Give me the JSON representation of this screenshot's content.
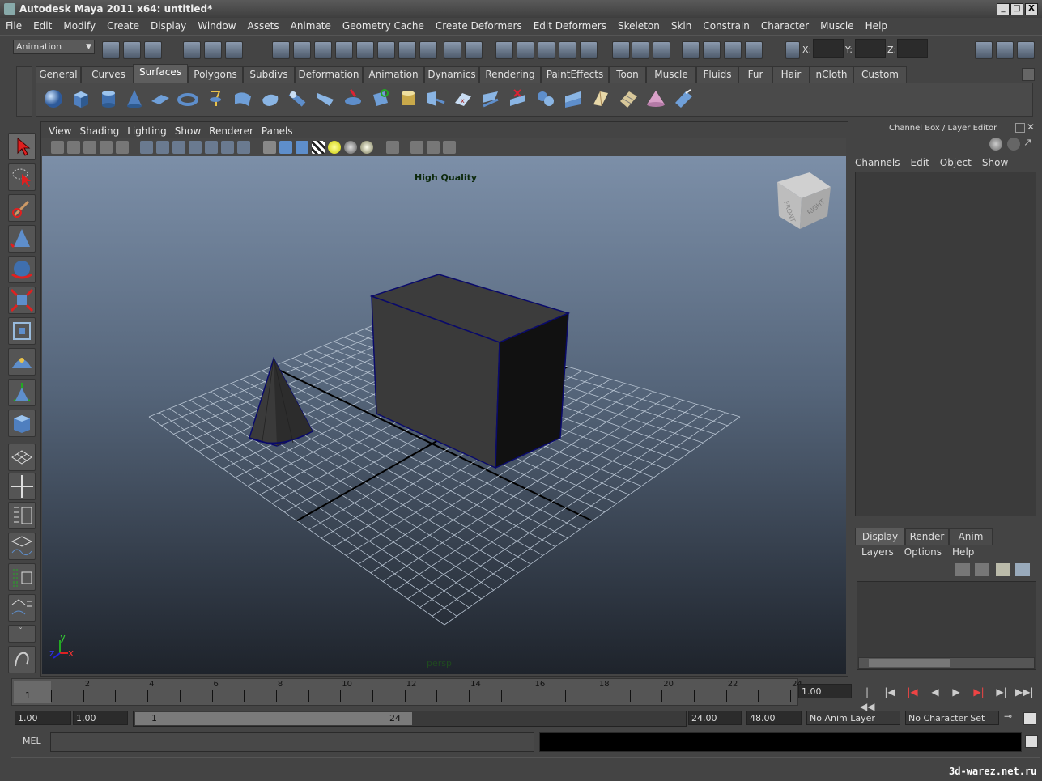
{
  "window": {
    "title": "Autodesk Maya 2011 x64: untitled*",
    "min": "_",
    "max": "□",
    "close": "X"
  },
  "menu": [
    "File",
    "Edit",
    "Modify",
    "Create",
    "Display",
    "Window",
    "Assets",
    "Animate",
    "Geometry Cache",
    "Create Deformers",
    "Edit Deformers",
    "Skeleton",
    "Skin",
    "Constrain",
    "Character",
    "Muscle",
    "Help"
  ],
  "status": {
    "menuset": "Animation",
    "x_label": "X:",
    "y_label": "Y:",
    "z_label": "Z:"
  },
  "shelf": {
    "tabs": [
      "General",
      "Curves",
      "Surfaces",
      "Polygons",
      "Subdivs",
      "Deformation",
      "Animation",
      "Dynamics",
      "Rendering",
      "PaintEffects",
      "Toon",
      "Muscle",
      "Fluids",
      "Fur",
      "Hair",
      "nCloth",
      "Custom"
    ],
    "active": "Surfaces"
  },
  "panel": {
    "menus": [
      "View",
      "Shading",
      "Lighting",
      "Show",
      "Renderer",
      "Panels"
    ],
    "hud_quality": "High Quality",
    "camera_name": "persp",
    "axis_y": "y",
    "axis_x": "x",
    "axis_z": "z",
    "viewcube_front": "FRONT",
    "viewcube_right": "RIGHT"
  },
  "channel_box": {
    "title": "Channel Box / Layer Editor",
    "menus": [
      "Channels",
      "Edit",
      "Object",
      "Show"
    ],
    "layer_tabs": [
      "Display",
      "Render",
      "Anim"
    ],
    "layer_menus": [
      "Layers",
      "Options",
      "Help"
    ]
  },
  "time_slider": {
    "ticks": [
      "2",
      "4",
      "6",
      "8",
      "10",
      "12",
      "14",
      "16",
      "18",
      "20",
      "22",
      "24"
    ],
    "current_frame": "1",
    "current_time": "1.00"
  },
  "range": {
    "start_time": "1.00",
    "start_range": "1.00",
    "range_left": "1",
    "range_right": "24",
    "end_range": "24.00",
    "end_time": "48.00",
    "anim_layer": "No Anim Layer",
    "character_set": "No Character Set"
  },
  "command_line": {
    "label": "MEL"
  },
  "watermark": "3d-warez.net.ru",
  "colors": {
    "bg": "#444444",
    "viewport_top": "#7c8fa8",
    "viewport_bottom": "#1e232b",
    "selection": "#0a0a6a"
  }
}
